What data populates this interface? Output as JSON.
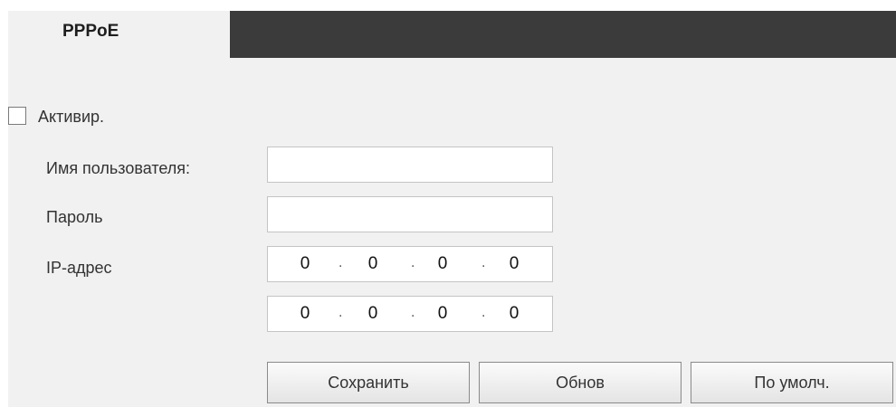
{
  "tabs": {
    "active_label": "PPPoE"
  },
  "form": {
    "enable_label": "Активир.",
    "enable_checked": false,
    "username_label": "Имя пользователя:",
    "username_value": "",
    "password_label": "Пароль",
    "password_value": "",
    "ip_label": "IP-адрес",
    "ip_address": [
      "0",
      "0",
      "0",
      "0"
    ],
    "ip_address_2": [
      "0",
      "0",
      "0",
      "0"
    ],
    "dot": "."
  },
  "buttons": {
    "save_label": "Сохранить",
    "refresh_label": "Обнов",
    "default_label": "По умолч."
  },
  "colors": {
    "panel_bg": "#f1f1f1",
    "tabbar_bg": "#3b3b3b"
  }
}
